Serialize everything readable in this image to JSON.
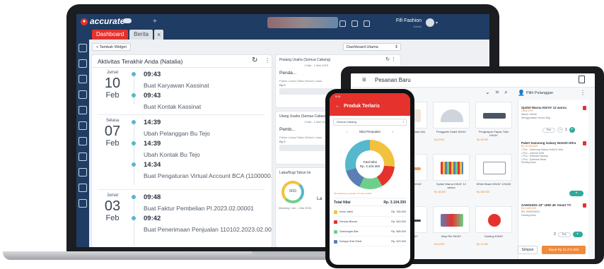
{
  "colors": {
    "accent_red": "#e5322d",
    "nav_navy": "#1f3c64",
    "timeline_teal": "#56b8cc",
    "pay_orange": "#f08a3c"
  },
  "laptop": {
    "app": {
      "logo_text": "accurate",
      "logo_icon": "cloud-icon",
      "new_tab_symbol": "+"
    },
    "header": {
      "company_name": "Fifi Fashion",
      "company_sub": "Admin"
    },
    "tabs": [
      {
        "label": "Dashboard",
        "active": true
      },
      {
        "label": "Berita",
        "active": false
      }
    ],
    "tab_close_symbol": "×",
    "toolbar": {
      "add_widget_label": "+ Tambah Widget",
      "dashboard_select": "Dashboard Utama"
    },
    "sidebar_icons": [
      "gear-icon",
      "home-icon",
      "building-icon",
      "file-icon",
      "store-icon",
      "cart-icon",
      "basket-icon",
      "truck-icon",
      "chart-icon",
      "report-icon",
      "settings-icon"
    ],
    "activity": {
      "title": "Aktivitas Terakhir Anda (Natalia)",
      "refresh_symbol": "↻",
      "days": [
        {
          "day_name": "Jumat",
          "day_num": "10",
          "month": "Feb",
          "entries": [
            {
              "time": "09:43",
              "desc": "Buat Karyawan Kassinat"
            },
            {
              "time": "09:43",
              "desc": "Buat Kontak Kassinat"
            }
          ]
        },
        {
          "day_name": "Selasa",
          "day_num": "07",
          "month": "Feb",
          "entries": [
            {
              "time": "14:39",
              "desc": "Ubah Pelanggan Bu Tejo"
            },
            {
              "time": "14:39",
              "desc": "Ubah Kontak Bu Tejo"
            },
            {
              "time": "14:34",
              "desc": "Buat Pengaturan Virtual Account BCA (1100000..."
            }
          ]
        },
        {
          "day_name": "Jumat",
          "day_num": "03",
          "month": "Feb",
          "entries": [
            {
              "time": "09:48",
              "desc": "Buat Faktur Pembelian PI.2023.02.00001"
            },
            {
              "time": "09:42",
              "desc": "Buat Penerimaan Penjualan 110102.2023.02.00..."
            }
          ]
        }
      ]
    },
    "widgets": [
      {
        "title": "Piutang Usaha (Semua Cabang)",
        "range": "1 Mar - 1 Mar 2023",
        "label": "Penda...",
        "sub": "Faktur Lunas   Faktur Belum Lunas",
        "value": "Rp 0"
      },
      {
        "title": "Utang Usaha (Semua Cabang)",
        "range": "1 Mar - 1 Mar 2023",
        "label": "Pemb...",
        "sub": "Faktur Lunas   Faktur Belum Lunas",
        "value": "Rp 0"
      },
      {
        "title": "Laba/Rugi Tahun Ini",
        "gauge_text": "0/10",
        "gauge_caption": "(Standing 1 Jan - 1 Mar 2023)",
        "label": "La"
      }
    ]
  },
  "tablet": {
    "title": "Pesanan Baru",
    "customer_label": "Pilih Pelanggan",
    "products": [
      {
        "name": "Kertas HVS A4 Klasik (W)",
        "price": "Rp 50.000"
      },
      {
        "name": "Penggaris Sudut KIKAY",
        "price": "Rp 8.000"
      },
      {
        "name": "Penghapus Papan Tulis KIKAY",
        "price": "Rp 15.000"
      },
      {
        "name": "Pensil Warna KIKAY",
        "price": "Rp 25.000"
      },
      {
        "name": "Spidol Warna KIKAY 12 warna",
        "price": "Rp 48.000"
      },
      {
        "name": "White Board KIKAY 120x90",
        "price": "Rp 350.000"
      },
      {
        "name": "Map File KIKAY",
        "price": "Rp 5.000"
      },
      {
        "name": "Gunting KIKAY",
        "price": "Rp 12.000"
      },
      {
        "name": "Pulpen KIKAY",
        "price": "Rp 3.000"
      }
    ],
    "order_items": [
      {
        "name": "Spidol Warna KIKAY 12 warna",
        "meta": "Obral 10%",
        "lines": [
          "Warna: Merah",
          "Menggunakan Nomor Bag"
        ],
        "qty": "1",
        "pill": "Pcs"
      },
      {
        "name": "Paket Samsung Galaxy Note20 Ultra",
        "meta": "Rp 21.000.000",
        "lines": [
          "1 Pcs - Samsung Galaxy Note20 Ultra",
          "1 Pcs - Internet USB",
          "1 Pcs - Software Backup",
          "1 Pcs - Software Bless",
          "Packing Baru"
        ],
        "qty": "",
        "pill": ""
      },
      {
        "name": "SAMSUNG 43\" UHD 4K Smart TV",
        "meta": "Rp 5.499.000",
        "lines": [
          "SN: 0000000001",
          "Packing Baru"
        ],
        "qty": "2",
        "pill": "Pcs"
      }
    ],
    "save_label": "Simpan",
    "pay_label": "Bayar Rp 31.271.000"
  },
  "phone": {
    "status_time": "9:41",
    "title": "Produk Terlaris",
    "branch_select": "Semua Cabang",
    "chart_tabs": [
      "‹",
      "Nilai Penjualan",
      "›"
    ],
    "donut_center": {
      "label": "Total Nilai",
      "value": "Rp. 3.104.350"
    },
    "note": "*Berdasarkan penjualan 5 bulan terakhir",
    "total": {
      "label": "Total Nilai",
      "value": "Rp. 3.104.350"
    },
    "rows": [
      {
        "name": "Kaos Jaket",
        "value": "Rp. 780.000",
        "color": "#f2c23e"
      },
      {
        "name": "Fenesa Blouse",
        "value": "Rp. 640.000",
        "color": "#e5322d"
      },
      {
        "name": "Gardungan Biar",
        "value": "Rp. 585.000",
        "color": "#6fcf8a"
      },
      {
        "name": "Kebaya Shiri Panti",
        "value": "Rp. 420.000",
        "color": "#5a7fb5"
      }
    ]
  }
}
